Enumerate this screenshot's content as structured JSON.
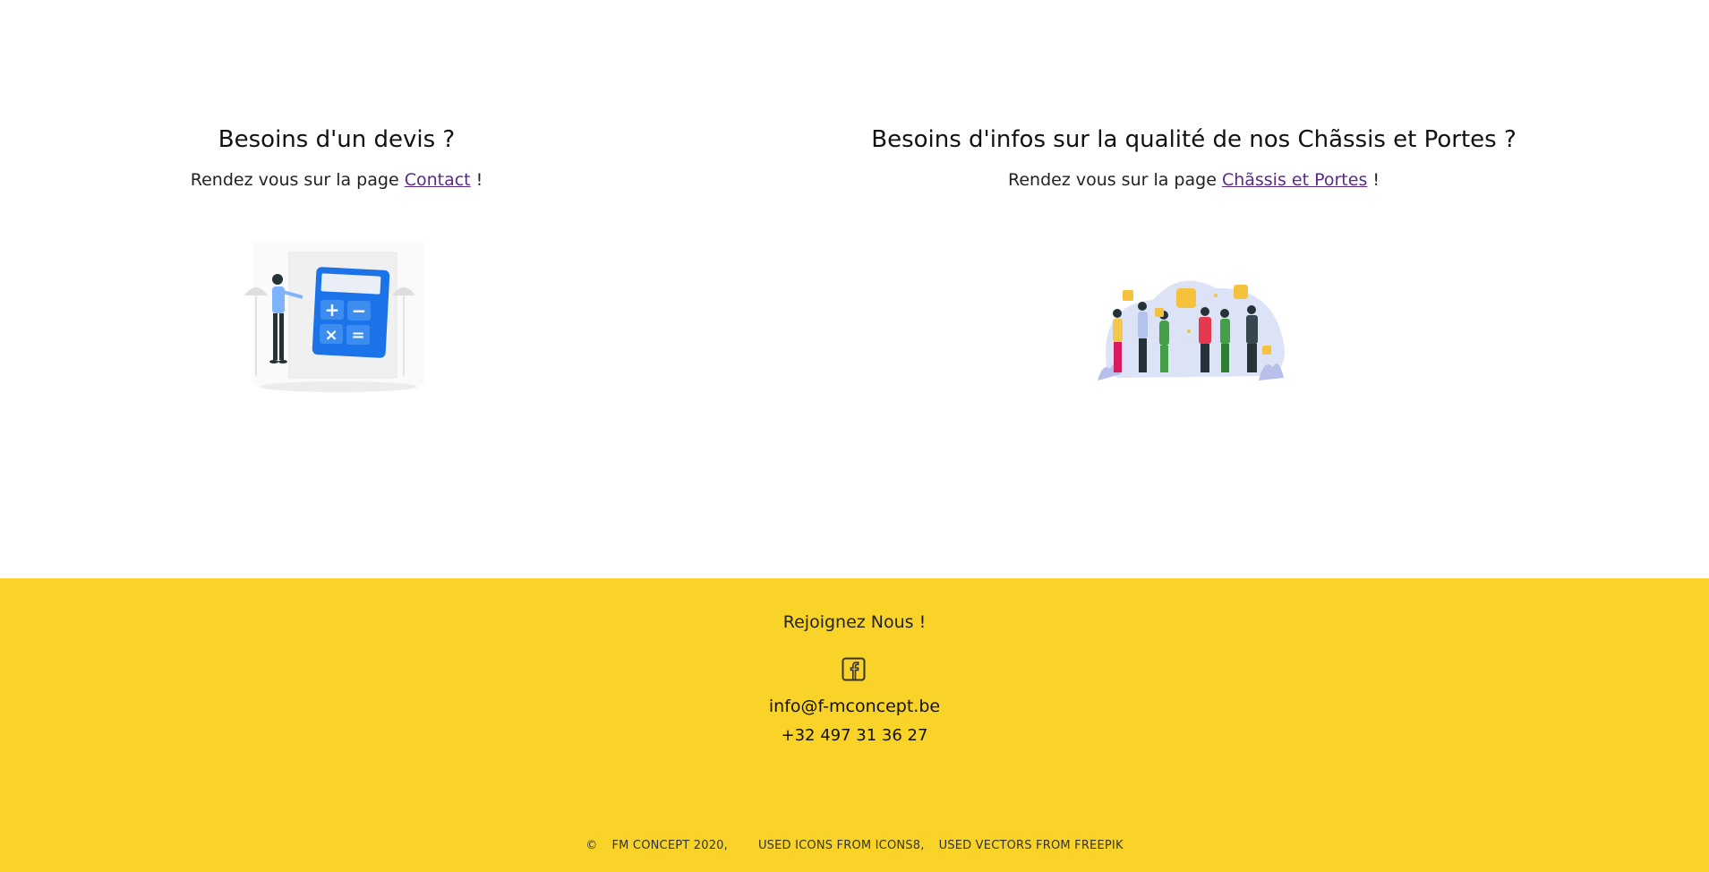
{
  "left_block": {
    "title": "Besoins d'un devis ?",
    "text_prefix": "Rendez vous sur la page ",
    "link_label": "Contact",
    "text_suffix": " !"
  },
  "right_block": {
    "title": "Besoins d'infos sur la qualité de nos Chãssis et Portes ?",
    "text_prefix": "Rendez vous sur la page ",
    "link_label": "Chãssis et Portes",
    "text_suffix": " !"
  },
  "footer": {
    "join_label": "Rejoignez Nous !",
    "social_icon": "facebook-icon",
    "email": "info@f-mconcept.be",
    "phone": "+32 497 31 36 27",
    "copyright_symbol": "©",
    "copyright": "FM CONCEPT 2020,",
    "icons_credit": "USED ICONS FROM ICONS8,",
    "vectors_credit": "USED VECTORS FROM FREEPIK"
  },
  "colors": {
    "footer_bg": "#f9d327",
    "link": "#5a2a8a",
    "calculator_blue": "#1a73e8"
  }
}
